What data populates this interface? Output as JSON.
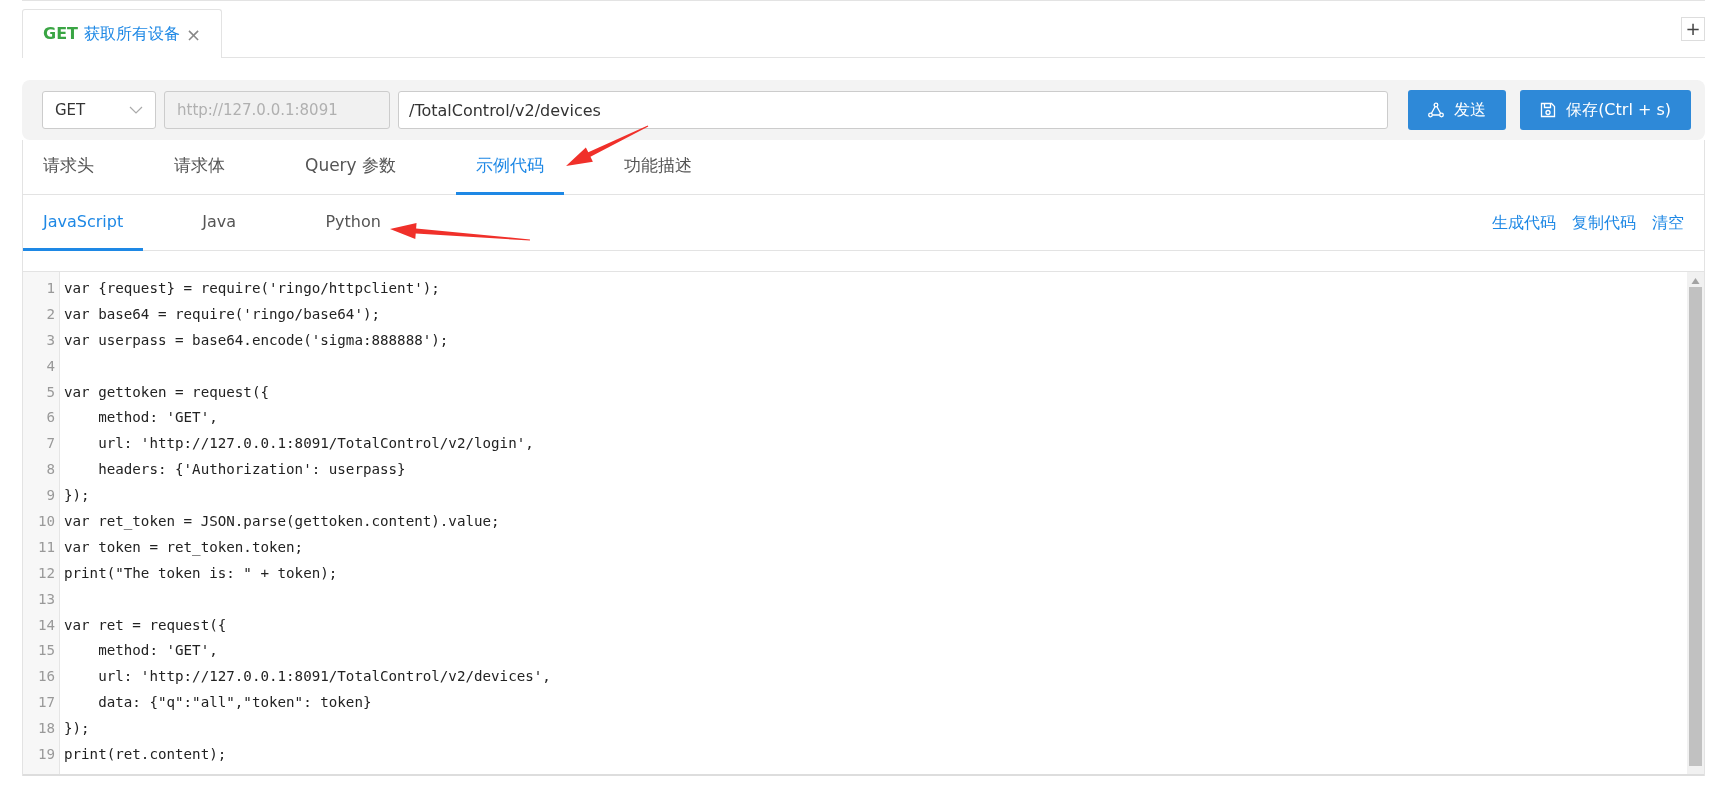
{
  "tabs": [
    {
      "method": "GET",
      "title": "获取所有设备",
      "close": "×",
      "selected": true
    }
  ],
  "add_tab": "+",
  "request": {
    "method": "GET",
    "base_url": "http://127.0.0.1:8091",
    "path": "/TotalControl/v2/devices"
  },
  "buttons": [
    {
      "kind": "send",
      "label": "发送"
    },
    {
      "kind": "save",
      "label": "保存(Ctrl + s)"
    }
  ],
  "section_tabs": [
    {
      "label": "请求头",
      "selected": false
    },
    {
      "label": "请求体",
      "selected": false
    },
    {
      "label": "Query 参数",
      "selected": false
    },
    {
      "label": "示例代码",
      "selected": true
    },
    {
      "label": "功能描述",
      "selected": false
    }
  ],
  "language_tabs": [
    {
      "label": "JavaScript",
      "selected": true
    },
    {
      "label": "Java",
      "selected": false
    },
    {
      "label": "Python",
      "selected": false
    }
  ],
  "actions": [
    "生成代码",
    "复制代码",
    "清空"
  ],
  "code": {
    "lines": [
      {
        "number": "1",
        "text": "var {request} = require('ringo/httpclient');"
      },
      {
        "number": "2",
        "text": "var base64 = require('ringo/base64');"
      },
      {
        "number": "3",
        "text": "var userpass = base64.encode('sigma:888888');"
      },
      {
        "number": "4"
      },
      {
        "number": "5",
        "text": "var gettoken = request({"
      },
      {
        "number": "6",
        "text": "    method: 'GET',"
      },
      {
        "number": "7",
        "text": "    url: 'http://127.0.0.1:8091/TotalControl/v2/login',"
      },
      {
        "number": "8",
        "text": "    headers: {'Authorization': userpass}"
      },
      {
        "number": "9",
        "text": "});"
      },
      {
        "number": "10",
        "text": "var ret_token = JSON.parse(gettoken.content).value;"
      },
      {
        "number": "11",
        "text": "var token = ret_token.token;"
      },
      {
        "number": "12",
        "text": "print(\"The token is: \" + token);"
      },
      {
        "number": "13"
      },
      {
        "number": "14",
        "text": "var ret = request({"
      },
      {
        "number": "15",
        "text": "    method: 'GET',"
      },
      {
        "number": "16",
        "text": "    url: 'http://127.0.0.1:8091/TotalControl/v2/devices',"
      },
      {
        "number": "17",
        "text": "    data: {\"q\":\"all\",\"token\": token}"
      },
      {
        "number": "18",
        "text": "});"
      },
      {
        "number": "19",
        "text": "print(ret.content);"
      }
    ]
  },
  "annotations": [
    {
      "kind": "arrow"
    },
    {
      "kind": "arrow"
    }
  ]
}
